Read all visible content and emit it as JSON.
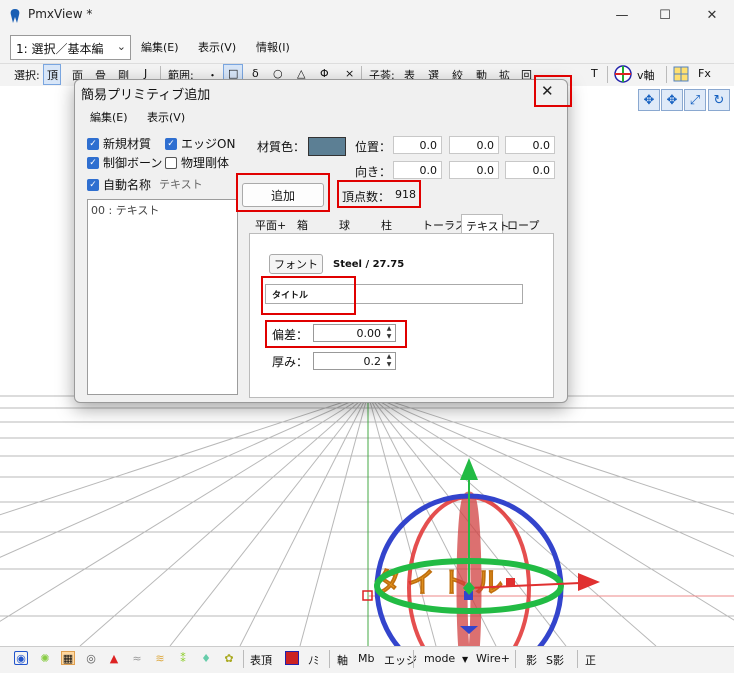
{
  "window": {
    "title": "PmxView *",
    "minimize": "—",
    "maximize": "☐",
    "close": "✕"
  },
  "menubar": {
    "mode_combo": "1: 選択／基本編",
    "items": [
      "編集(E)",
      "表示(V)",
      "情報(I)"
    ]
  },
  "toolbar": {
    "select_label": "選択:",
    "select_items": [
      "頂",
      "面",
      "骨",
      "剛",
      "J"
    ],
    "range_label": "範囲:",
    "range_items": [
      "・",
      "□",
      "δ",
      "○",
      "△",
      "Φ",
      "×"
    ],
    "coord_label": "子荟:",
    "coord_items": [
      "表",
      "選",
      "絞",
      "動",
      "拡",
      "回",
      "T"
    ],
    "vaxis": "v軸",
    "fx": "Fx"
  },
  "dialog": {
    "title": "簡易プリミティブ追加",
    "close": "✕",
    "menu": [
      "編集(E)",
      "表示(V)"
    ],
    "checkboxes": {
      "new_material": {
        "label": "新規材質",
        "checked": true
      },
      "edge_on": {
        "label": "エッジON",
        "checked": true
      },
      "control_bone": {
        "label": "制御ボーン",
        "checked": true
      },
      "physics_body": {
        "label": "物理剛体",
        "checked": false
      },
      "auto_name": {
        "label": "自動名称",
        "checked": true
      }
    },
    "auto_name_value": "テキスト",
    "list_items": [
      "00 : テキスト"
    ],
    "material_color_label": "材質色：",
    "material_color": "#5c7f94",
    "position_label": "位置：",
    "position": [
      "0.0",
      "0.0",
      "0.0"
    ],
    "direction_label": "向き：",
    "direction": [
      "0.0",
      "0.0",
      "0.0"
    ],
    "add_button": "追加",
    "vertex_count_label": "頂点数：",
    "vertex_count": "918",
    "tabs": [
      "平面+",
      "箱",
      "球",
      "柱",
      "トーラス",
      "テキスト",
      "ロープ"
    ],
    "active_tab": "テキスト",
    "font_button": "フォント",
    "font_info": "Steel / 27.75",
    "text_value": "タイトル",
    "deviation_label": "偏差：",
    "deviation": "0.00",
    "thickness_label": "厚み：",
    "thickness": "0.2"
  },
  "statusbar": {
    "items": [
      "表頂",
      "ﾉﾐ",
      "軸",
      "Mb",
      "エッジ",
      "mode",
      "Wire+",
      "影",
      "S影",
      "正"
    ]
  },
  "colors": {
    "highlight": "#e00000",
    "accent": "#2f6fd0",
    "gizmo_blue": "#3344cc",
    "gizmo_red": "#e03030",
    "gizmo_green": "#22bb44",
    "text_orange": "#f0a020"
  }
}
